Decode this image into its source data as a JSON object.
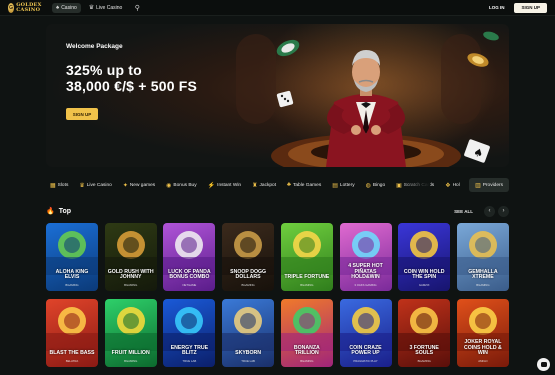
{
  "header": {
    "logo_text": "GOLDEX CASINO",
    "logo_mark": "G",
    "tabs": [
      {
        "label": "Casino",
        "icon": "spade-icon",
        "glyph": "♠",
        "active": true
      },
      {
        "label": "Live Casino",
        "icon": "dealer-icon",
        "glyph": "♛",
        "active": false
      }
    ],
    "search_icon": "⚲",
    "login_label": "LOG IN",
    "signup_label": "SIGN UP"
  },
  "hero": {
    "eyebrow": "Welcome Package",
    "title_line1": "325% up to",
    "title_line2": "38,000 €/$ + 500 FS",
    "cta_label": "SIGN UP"
  },
  "categories": [
    {
      "label": "Slots",
      "icon": "slots-icon",
      "glyph": "▦"
    },
    {
      "label": "Live Casino",
      "icon": "dealer-icon",
      "glyph": "♛"
    },
    {
      "label": "New games",
      "icon": "new-icon",
      "glyph": "✦"
    },
    {
      "label": "Bonus Buy",
      "icon": "coin-icon",
      "glyph": "◉"
    },
    {
      "label": "Instant Win",
      "icon": "bolt-icon",
      "glyph": "⚡"
    },
    {
      "label": "Jackpot",
      "icon": "trophy-icon",
      "glyph": "♜"
    },
    {
      "label": "Table Games",
      "icon": "table-icon",
      "glyph": "♣"
    },
    {
      "label": "Lottery",
      "icon": "ticket-icon",
      "glyph": "▤"
    },
    {
      "label": "Bingo",
      "icon": "bingo-icon",
      "glyph": "◍"
    },
    {
      "label": "Scratch Cards",
      "icon": "scratch-icon",
      "glyph": "▣"
    },
    {
      "label": "Hol",
      "icon": "gift-icon",
      "glyph": "❖"
    }
  ],
  "providers_label": "Providers",
  "providers_glyph": "▥",
  "section": {
    "title": "Top",
    "icon_glyph": "🔥",
    "see_all_label": "SEE ALL",
    "prev_glyph": "‹",
    "next_glyph": "›"
  },
  "games_row1": [
    {
      "name": "ALOHA KING ELVIS",
      "provider": "BGAMING",
      "bg1": "#1b6fd6",
      "bg2": "#0b3a78",
      "accent": "#6ad04a"
    },
    {
      "name": "GOLD RUSH WITH JOHNNY",
      "provider": "BGAMING",
      "bg1": "#2e3a14",
      "bg2": "#14190b",
      "accent": "#e0a23a"
    },
    {
      "name": "LUCK OF PANDA BONUS COMBO",
      "provider": "NETGAME",
      "bg1": "#b054d8",
      "bg2": "#5a1c8a",
      "accent": "#f3f3f3"
    },
    {
      "name": "SNOOP DOGG DOLLARS",
      "provider": "BGAMING",
      "bg1": "#3b2a1c",
      "bg2": "#17110b",
      "accent": "#d1a24a"
    },
    {
      "name": "TRIPLE FORTUNE",
      "provider": "BGAMING",
      "bg1": "#6fcf3e",
      "bg2": "#2f7d1c",
      "accent": "#ffd84a"
    },
    {
      "name": "4 SUPER HOT PIÑATAS HOLD&WIN",
      "provider": "3 OAKS GAMING",
      "bg1": "#e06ad0",
      "bg2": "#7a2a9a",
      "accent": "#6ae0ff"
    },
    {
      "name": "COIN WIN HOLD THE SPIN",
      "provider": "GAMZIX",
      "bg1": "#3a36d8",
      "bg2": "#17146e",
      "accent": "#ffcf3a"
    },
    {
      "name": "GEMHALLA XTREME",
      "provider": "BGAMING",
      "bg1": "#7aa8d8",
      "bg2": "#3a5c8a",
      "accent": "#f0c24a"
    }
  ],
  "games_row2": [
    {
      "name": "BLAST THE BASS",
      "provider": "BELATRA",
      "bg1": "#e0442a",
      "bg2": "#8a1a14",
      "accent": "#ffd04a"
    },
    {
      "name": "FRUIT MILLION",
      "provider": "BGAMING",
      "bg1": "#2ed06a",
      "bg2": "#0c6a2e",
      "accent": "#ffdc3a"
    },
    {
      "name": "ENERGY TRUE BLITZ",
      "provider": "TRUE LAB",
      "bg1": "#1a5ad8",
      "bg2": "#0b1f6a",
      "accent": "#3ad0ff"
    },
    {
      "name": "SKYBORN",
      "provider": "TRUE LAB",
      "bg1": "#3a7ad8",
      "bg2": "#1a2f6a",
      "accent": "#f3d27a"
    },
    {
      "name": "BONANZA TRILLION",
      "provider": "BGAMING",
      "bg1": "#f07a2a",
      "bg2": "#a0247a",
      "accent": "#3ad06a"
    },
    {
      "name": "COIN CRAZE POWER UP",
      "provider": "PRAGMATIC PLAY",
      "bg1": "#3a6ae0",
      "bg2": "#1a1f8a",
      "accent": "#ffd23a"
    },
    {
      "name": "3 FORTUNE SOULS",
      "provider": "BGAMING",
      "bg1": "#c0321a",
      "bg2": "#5a0f0a",
      "accent": "#ffcf4a"
    },
    {
      "name": "JOKER ROYAL COINS HOLD & WIN",
      "provider": "AMIGO",
      "bg1": "#e0501a",
      "bg2": "#7a1a0a",
      "accent": "#ffd84a"
    }
  ]
}
